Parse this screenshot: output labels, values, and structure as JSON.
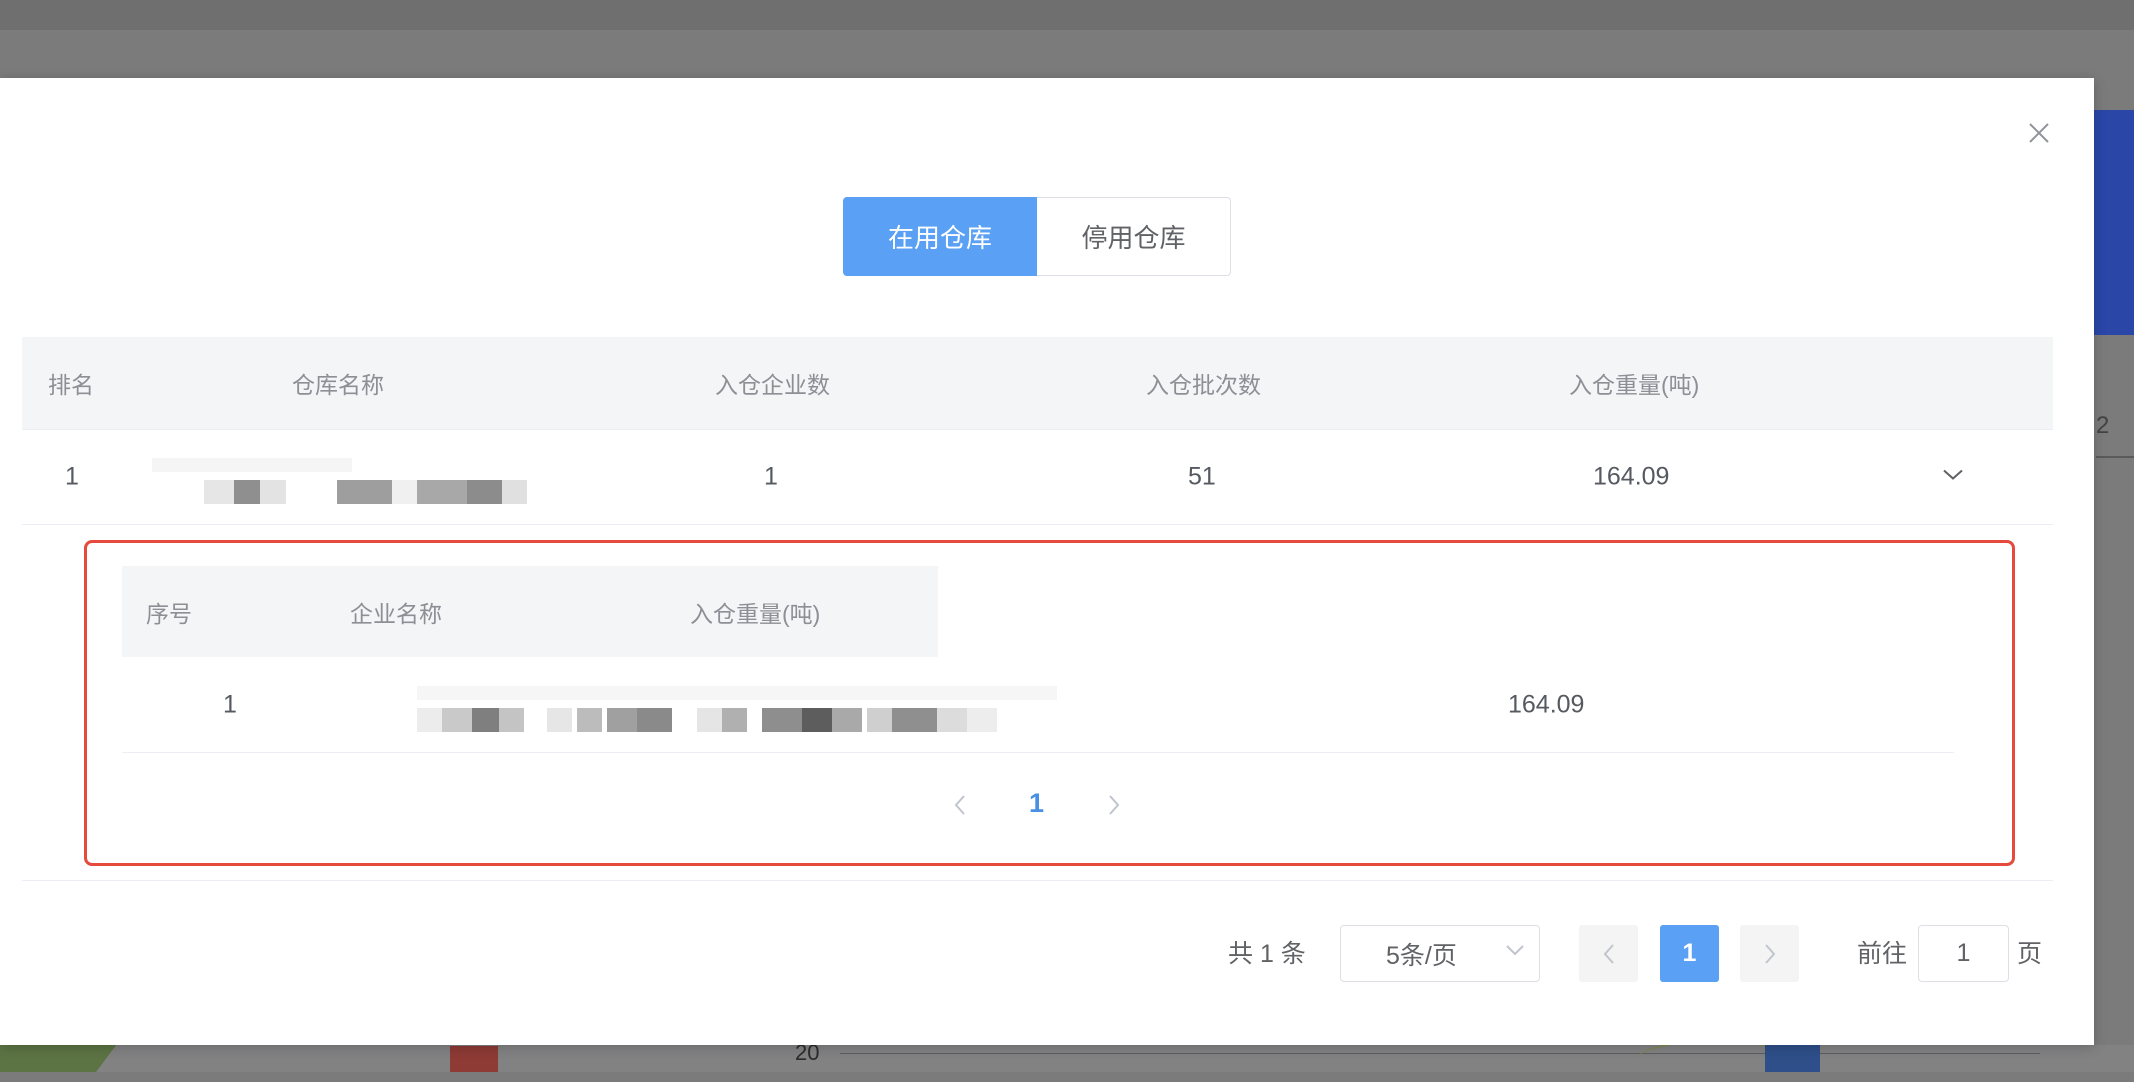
{
  "background": {
    "axis_tick": "20",
    "right_fragment": "2"
  },
  "dialog": {
    "tabs": [
      {
        "label": "在用仓库",
        "active": true
      },
      {
        "label": "停用仓库",
        "active": false
      }
    ],
    "table": {
      "columns": [
        "排名",
        "仓库名称",
        "入仓企业数",
        "入仓批次数",
        "入仓重量(吨)"
      ],
      "rows": [
        {
          "rank": "1",
          "name": "",
          "enterprise_count": "1",
          "batch_count": "51",
          "weight": "164.09"
        }
      ]
    },
    "expanded": {
      "columns": [
        "序号",
        "企业名称",
        "入仓重量(吨)"
      ],
      "rows": [
        {
          "index": "1",
          "name": "",
          "weight": "164.09"
        }
      ],
      "pager": {
        "current": "1"
      }
    },
    "pager": {
      "total": "共 1 条",
      "page_size": "5条/页",
      "current": "1",
      "goto_prefix": "前往",
      "goto_value": "1",
      "goto_suffix": "页"
    }
  },
  "colors": {
    "primary": "#5aa0f5",
    "highlight_border": "#e54a3c",
    "header_bg": "#f4f5f7"
  },
  "icons": [
    "close-icon",
    "chevron-down-icon",
    "chevron-left-icon",
    "chevron-right-icon"
  ]
}
